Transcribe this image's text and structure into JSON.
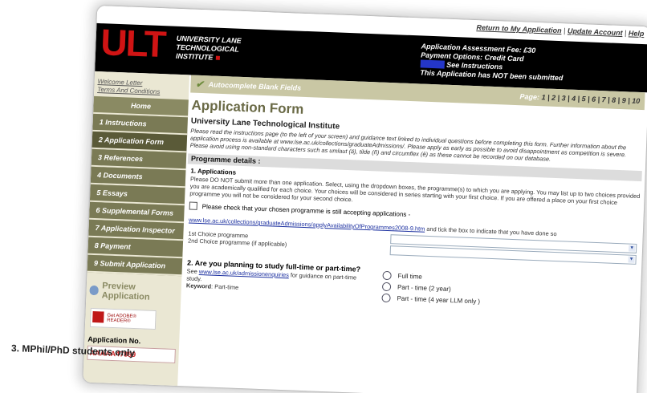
{
  "top_links": {
    "return": "Return to My Application",
    "update": "Update Account",
    "help": "Help",
    "sep1": "|",
    "sep2": "|"
  },
  "header": {
    "logo": "ULT",
    "inst_line1": "UNIVERSITY LANE",
    "inst_line2": "TECHNOLOGICAL",
    "inst_line3": "INSTITUTE",
    "fee": "Application Assessment Fee:  £30",
    "payment": "Payment Options:  Credit Card",
    "instructions": "See Instructions",
    "status": "This Application has NOT been submitted"
  },
  "sidebar": {
    "welcome": "Welcome Letter",
    "terms": "Terms And Conditions",
    "items": [
      {
        "label": "Home"
      },
      {
        "label": "1 Instructions"
      },
      {
        "label": "2 Application Form"
      },
      {
        "label": "3 References"
      },
      {
        "label": "4 Documents"
      },
      {
        "label": "5 Essays"
      },
      {
        "label": "6 Supplemental Forms"
      },
      {
        "label": "7 Application Inspector"
      },
      {
        "label": "8 Payment"
      },
      {
        "label": "9 Submit Application"
      }
    ],
    "preview": "Preview Application",
    "adobe": "Get ADOBE® READER®",
    "app_no_label": "Application No.",
    "app_no": "AAAAA47859"
  },
  "autobar": {
    "label": "Autocomplete Blank Fields",
    "pages_label": "Page:",
    "pages": "1 | 2 | 3 | 4 | 5 | 6 | 7 | 8 | 9 | 10"
  },
  "main": {
    "title": "Application Form",
    "subtitle": "University Lane Technological Institute",
    "intro": "Please read the instructions page (to the left of your screen) and guidance text linked to individual questions before completing this form. Further information about the application process is available at www.lse.ac.uk/collections/graduateAdmissions/. Please apply as early as possible to avoid disappointment as competition is severe. Please avoid using non-standard characters such as umlaut (ä), tilde (ñ) and circumflex (ê) as these cannot be recorded on our database.",
    "section": "Programme details :",
    "q1_title": "1. Applications",
    "q1_text": "Please DO NOT submit more than one application. Select, using the dropdown boxes, the programme(s) to which you are applying. You may list up to two choices provided you are academically qualified for each choice. Your choices will be considered in series starting with your first choice. If you are offered a place on your first choice programme you will not be considered for your second choice.",
    "checkbox_label": "Please check that your chosen programme is still accepting applications -",
    "link": "www.lse.ac.uk/collections/graduateAdmissions/applyAvailabilityOfProgrammes2008-9.htm",
    "link_suffix": "and tick the box to indicate that you have done so",
    "first_choice": "1st Choice programme",
    "second_choice": "2nd Choice programme (if applicable)",
    "q2_title": "2. Are you planning to study full-time or part-time?",
    "q2_see": "See",
    "q2_link": "www.lse.ac.uk/admissionenquiries",
    "q2_text": "for guidance on part-time study.",
    "q2_keyword_label": "Keyword",
    "q2_keyword": ": Part-time",
    "radio_full": "Full time",
    "radio_part2": "Part - time (2 year)",
    "radio_part4": "Part - time (4 year LLM only )",
    "q3_title": "3. MPhil/PhD students only"
  }
}
